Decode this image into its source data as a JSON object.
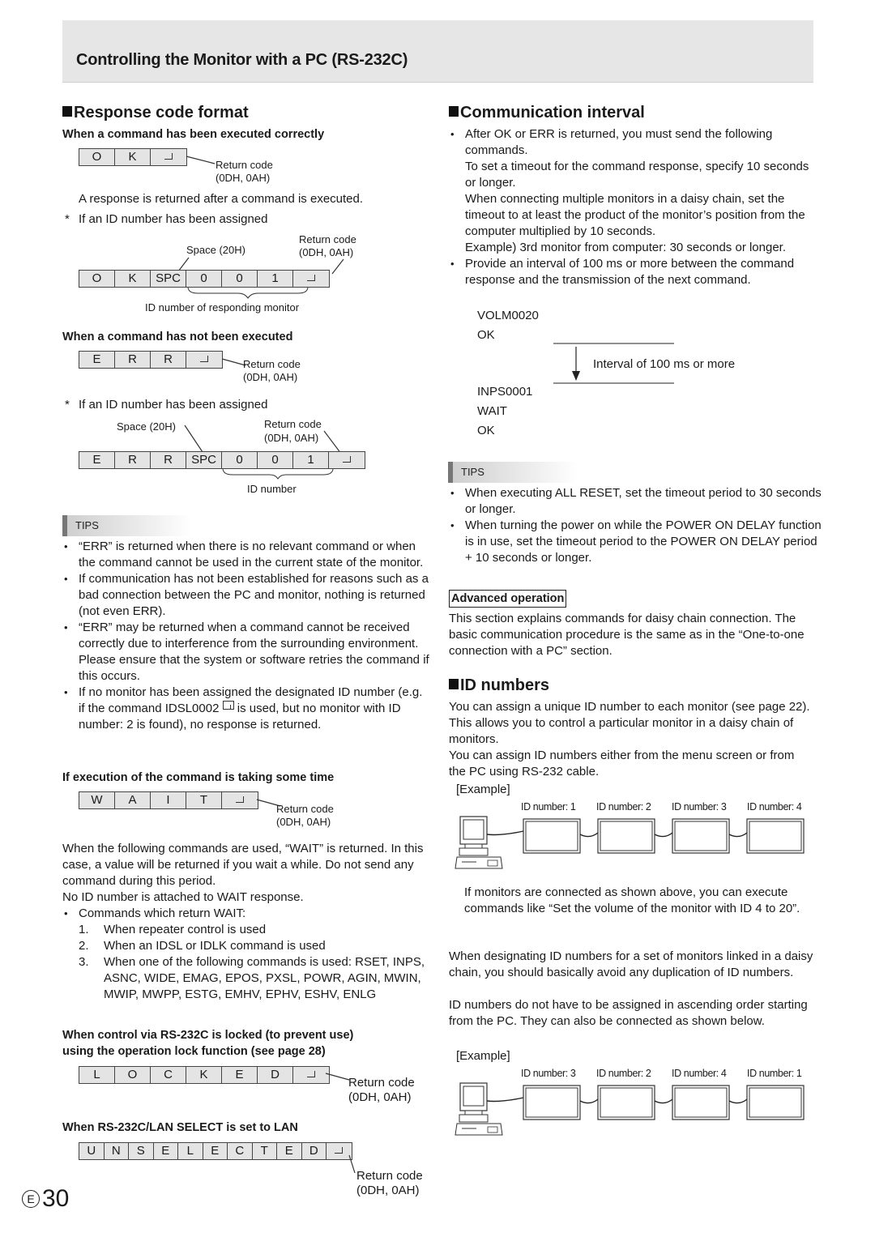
{
  "header": {
    "title": "Controlling the Monitor with a PC (RS-232C)"
  },
  "left": {
    "section_title": "Response code format",
    "ok": {
      "heading": "When a command has been executed correctly",
      "cells": [
        "O",
        "K",
        "RET"
      ],
      "return_label": "Return code",
      "return_hex": "(0DH, 0AH)",
      "description": "A response is returned after a command is executed.",
      "id_note_star": "*",
      "id_note": "If an ID number has been assigned",
      "id_cells": [
        "O",
        "K",
        "SPC",
        "0",
        "0",
        "1",
        "RET"
      ],
      "space_label": "Space (20H)",
      "id_return_label": "Return code",
      "id_return_hex": "(0DH, 0AH)",
      "id_brace_label": "ID number of responding monitor"
    },
    "err": {
      "heading": "When a command has not been executed",
      "cells": [
        "E",
        "R",
        "R",
        "RET"
      ],
      "return_label": "Return code",
      "return_hex": "(0DH, 0AH)",
      "id_note_star": "*",
      "id_note": "If an ID number has been assigned",
      "id_cells": [
        "E",
        "R",
        "R",
        "SPC",
        "0",
        "0",
        "1",
        "RET"
      ],
      "space_label": "Space (20H)",
      "id_return_label": "Return code",
      "id_return_hex": "(0DH, 0AH)",
      "id_brace_label": "ID number"
    },
    "tips": {
      "label": "TIPS",
      "items": [
        "“ERR” is returned when there is no relevant command or when the command cannot be used in the current state of the monitor.",
        "If communication has not been established for reasons such as a bad connection between the PC and monitor, nothing is returned (not even ERR).",
        "“ERR” may be returned when a command cannot be received correctly due to interference from the surrounding environment.",
        "Please ensure that the system or software retries the command if this occurs.",
        "If no monitor has been assigned the designated ID number (e.g. if the command IDSL0002",
        "is used, but no monitor with ID number: 2 is found), no response is returned."
      ]
    },
    "wait": {
      "heading": "If execution of the command is taking some time",
      "cells": [
        "W",
        "A",
        "I",
        "T",
        "RET"
      ],
      "return_label": "Return code",
      "return_hex": "(0DH, 0AH)",
      "para1": "When the following commands are used, “WAIT” is returned. In this case, a value will be returned if you wait a while. Do not send any command during this period.",
      "para2": "No ID number is attached to WAIT response.",
      "bullet": "Commands which return WAIT:",
      "list": [
        {
          "n": "1.",
          "text": "When repeater control is used"
        },
        {
          "n": "2.",
          "text": "When an IDSL or IDLK command is used"
        },
        {
          "n": "3.",
          "text": "When one of the following commands is used: RSET, INPS, ASNC, WIDE, EMAG, EPOS, PXSL, POWR, AGIN, MWIN, MWIP, MWPP, ESTG, EMHV, EPHV, ESHV, ENLG"
        }
      ]
    },
    "locked": {
      "heading_line1": "When control via RS-232C is locked (to prevent use)",
      "heading_line2": "using the operation lock function (see page 28)",
      "cells": [
        "L",
        "O",
        "C",
        "K",
        "E",
        "D",
        "RET"
      ],
      "return_label": "Return code",
      "return_hex": "(0DH, 0AH)"
    },
    "unselected": {
      "heading": "When RS-232C/LAN SELECT is set to LAN",
      "cells": [
        "U",
        "N",
        "S",
        "E",
        "L",
        "E",
        "C",
        "T",
        "E",
        "D",
        "RET"
      ],
      "return_label": "Return code",
      "return_hex": "(0DH, 0AH)"
    }
  },
  "right": {
    "comm": {
      "section_title": "Communication interval",
      "bullet1_lines": [
        "After OK or ERR is returned, you must send the following commands.",
        "To set a timeout for the command response, specify 10 seconds or longer.",
        "When connecting multiple monitors in a daisy chain, set the timeout to at least the product of the monitor’s position from the computer multiplied by 10 seconds.",
        "Example) 3rd monitor from computer: 30 seconds or longer."
      ],
      "bullet2": "Provide an interval of 100 ms or more between the command response and the transmission of the next command.",
      "sequence": [
        "VOLM0020",
        "OK",
        "INPS0001",
        "WAIT",
        "OK"
      ],
      "interval_label": "Interval of 100 ms or more"
    },
    "tips": {
      "label": "TIPS",
      "items": [
        "When executing ALL RESET, set the timeout period to 30 seconds or longer.",
        "When turning the power on while the POWER ON DELAY function is in use, set the timeout period to the POWER ON DELAY period + 10 seconds or longer."
      ]
    },
    "advanced": {
      "label": "Advanced operation",
      "text": "This section explains commands for daisy chain connection. The basic communication procedure is the same as in the “One-to-one connection with a PC” section."
    },
    "id": {
      "section_title": "ID numbers",
      "para1": "You can assign a unique ID number to each monitor (see page 22). This allows you to control a particular monitor in a daisy chain of monitors.",
      "para2": "You can assign ID numbers either from the menu screen or from the PC using RS-232 cable.",
      "example_label": "[Example]",
      "chain1": [
        "ID number: 1",
        "ID number: 2",
        "ID number: 3",
        "ID number: 4"
      ],
      "chain1_note": "If monitors are connected as shown above, you can execute commands like “Set the volume of the monitor with ID 4 to 20”.",
      "para3": "When designating ID numbers for a set of monitors linked in a daisy chain, you should basically avoid any duplication of ID numbers.",
      "para4": "ID numbers do not have to be assigned in ascending order starting from the PC. They can also be connected as shown below.",
      "example_label2": "[Example]",
      "chain2": [
        "ID number: 3",
        "ID number: 2",
        "ID number: 4",
        "ID number: 1"
      ]
    }
  },
  "footer": {
    "lang_mark": "E",
    "page_number": "30"
  }
}
